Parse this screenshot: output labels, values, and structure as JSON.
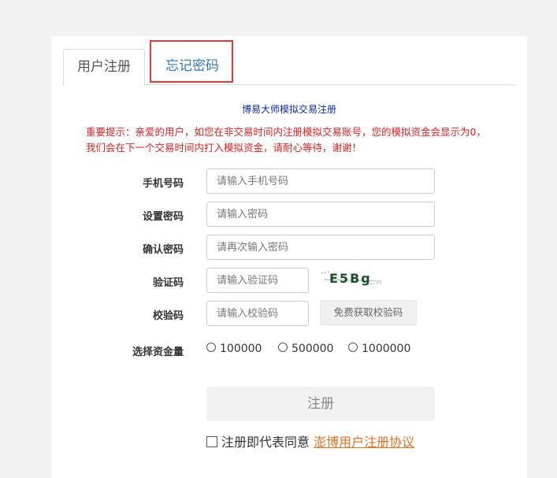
{
  "tabs": {
    "register": "用户注册",
    "forgot": "忘记密码"
  },
  "form": {
    "title": "博易大师模拟交易注册",
    "notice": "重要提示：亲爱的用户，如您在非交易时间内注册模拟交易账号，您的模拟资金会显示为0，我们会在下一个交易时间内打入模拟资金，请耐心等待，谢谢！",
    "phone": {
      "label": "手机号码",
      "placeholder": "请输入手机号码"
    },
    "password": {
      "label": "设置密码",
      "placeholder": "请输入密码"
    },
    "confirm": {
      "label": "确认密码",
      "placeholder": "请再次输入密码"
    },
    "captcha": {
      "label": "验证码",
      "placeholder": "请输入验证码",
      "image_text": "E5Bg"
    },
    "sms": {
      "label": "校验码",
      "placeholder": "请输入校验码",
      "button": "免费获取校验码"
    },
    "funds": {
      "label": "选择资金量",
      "options": [
        "100000",
        "500000",
        "1000000"
      ]
    },
    "submit": "注册",
    "agree_text": "注册即代表同意",
    "agree_link": "澎博用户注册协议"
  },
  "colors": {
    "notice": "#e02020",
    "title": "#0d28b8",
    "link": "#e8711f",
    "highlight": "#e0393e"
  }
}
